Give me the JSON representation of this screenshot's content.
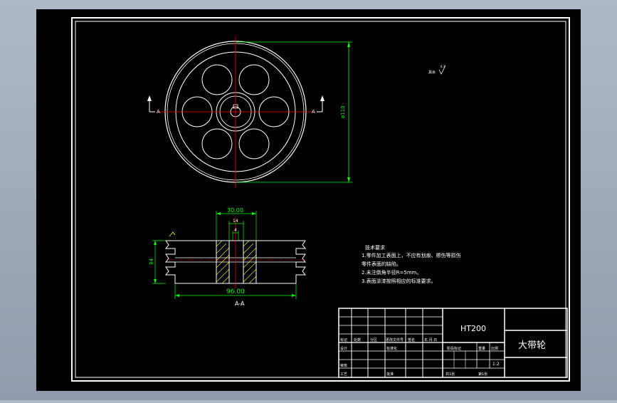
{
  "drawing": {
    "dimensions": {
      "diameter": "ø110",
      "hub_width": "30.00",
      "bore_dim": "14",
      "key_dim": "4",
      "height": "34",
      "total_width": "96.00"
    },
    "section_marks": {
      "left": "A",
      "right": "A"
    },
    "section_caption": "A-A",
    "roughness_note": "其余",
    "roughness_small": "6.3",
    "tech_requirements": {
      "heading": "技术要求",
      "lines": [
        "1.零件加工表面上，不应有划痕、擦伤等损伤",
        "  零件表面的缺陷。",
        "2.未注倒角半径R=5mm。",
        "3.表面涂漆按照相应的标准要求。"
      ]
    },
    "title_block": {
      "material": "HT200",
      "part_name": "大带轮",
      "labels": {
        "mark": "标记",
        "count": "处数",
        "zone": "分区",
        "change_doc": "更改文件号",
        "signature": "签名",
        "date": "年.月.日",
        "designer": "设计",
        "standardize": "标准化",
        "approve": "审核",
        "craft": "工艺",
        "ratify": "批准",
        "stage_mark": "阶段标记",
        "weight": "重量",
        "scale": "比例",
        "scale_value": "1:2",
        "sheets_total": "共1张",
        "sheet_no": "第1张"
      }
    },
    "colors": {
      "background": "#000000",
      "outline": "#ffffff",
      "dimension": "#00ff00",
      "centerline": "#ff0000",
      "hatch": "#ffff00",
      "marker": "#ffff00"
    }
  }
}
